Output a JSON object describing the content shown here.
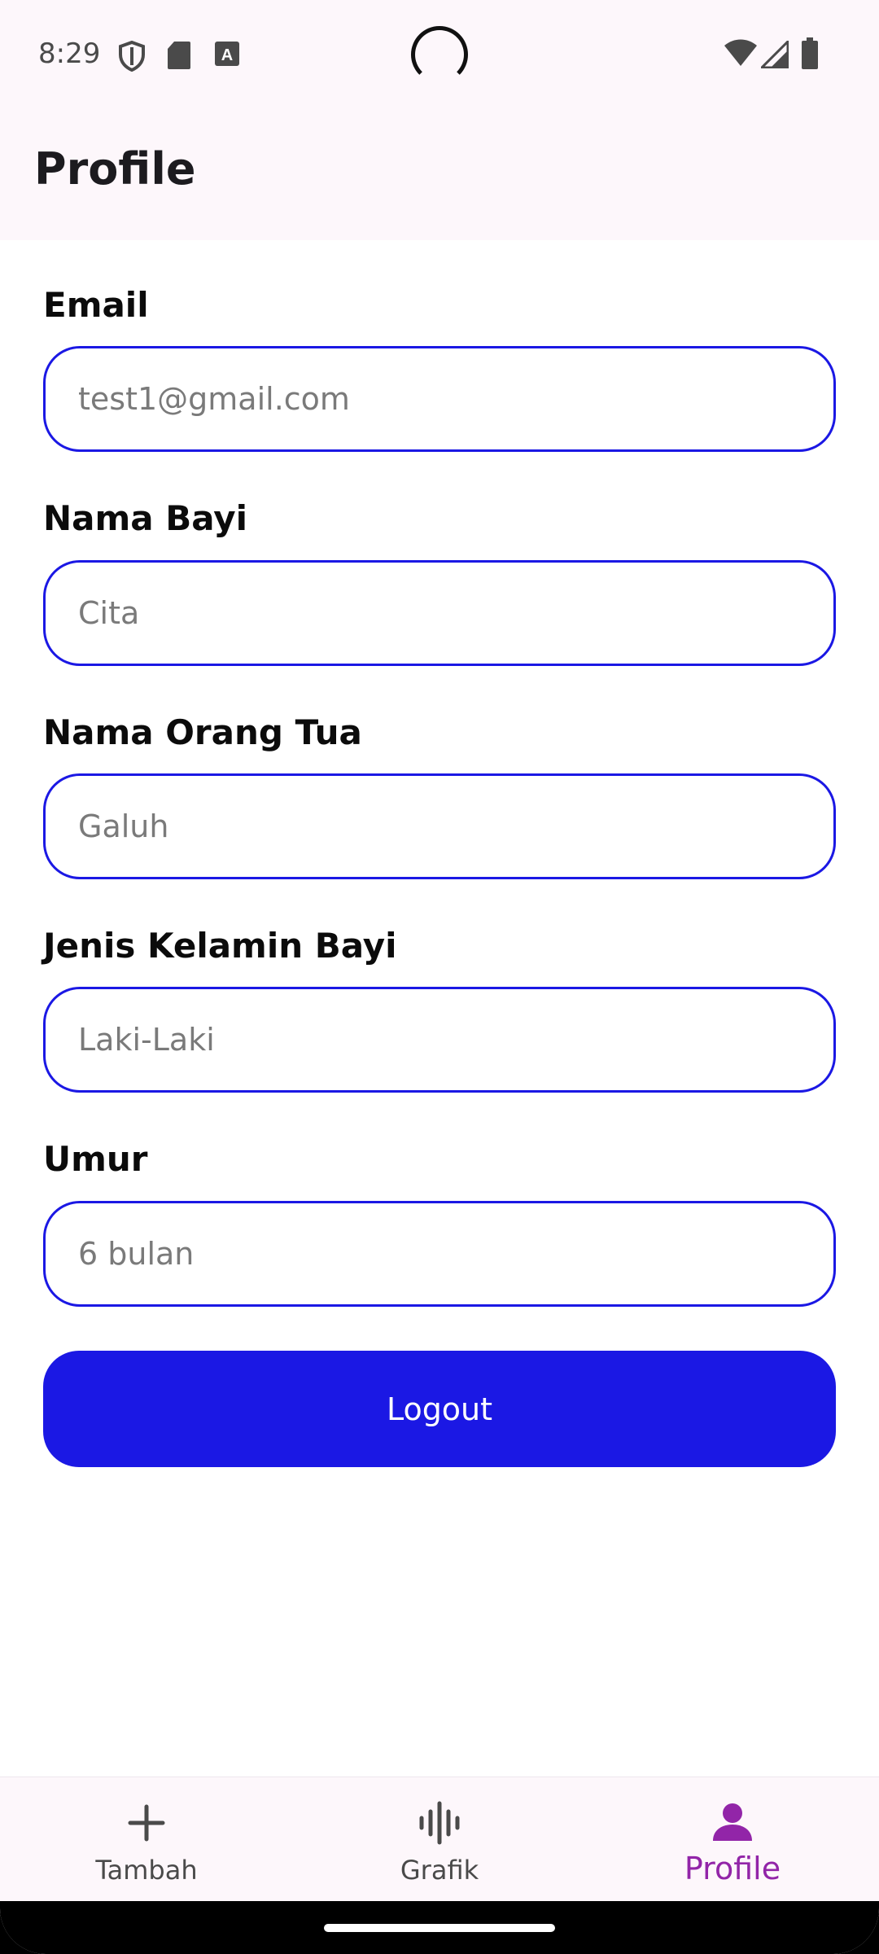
{
  "status_bar": {
    "time": "8:29",
    "icons": [
      "shield-icon",
      "sd-card-icon",
      "keyboard-a-icon",
      "wifi-icon",
      "signal-icon",
      "battery-icon"
    ]
  },
  "header": {
    "title": "Profile"
  },
  "form": {
    "fields": [
      {
        "label": "Email",
        "placeholder": "test1@gmail.com"
      },
      {
        "label": "Nama Bayi",
        "placeholder": "Cita"
      },
      {
        "label": "Nama Orang Tua",
        "placeholder": "Galuh"
      },
      {
        "label": "Jenis Kelamin Bayi",
        "placeholder": "Laki-Laki"
      },
      {
        "label": "Umur",
        "placeholder": "6 bulan"
      }
    ],
    "logout_label": "Logout"
  },
  "bottom_nav": {
    "items": [
      {
        "label": "Tambah",
        "icon": "plus-icon",
        "active": false
      },
      {
        "label": "Grafik",
        "icon": "waveform-icon",
        "active": false
      },
      {
        "label": "Profile",
        "icon": "person-icon",
        "active": true
      }
    ]
  },
  "colors": {
    "accent": "#1b18e4",
    "active_nav": "#9225a8",
    "surface": "#fdf7fb"
  }
}
